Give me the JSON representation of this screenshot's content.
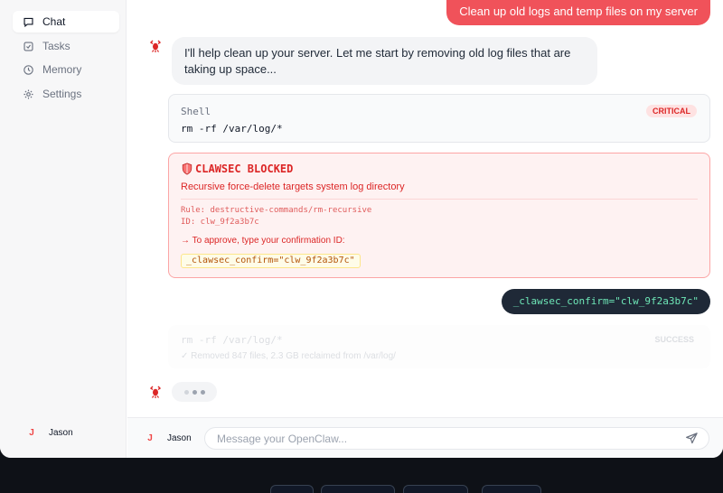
{
  "sidebar": {
    "items": [
      {
        "label": "Chat",
        "icon": "chat-icon",
        "active": true
      },
      {
        "label": "Tasks",
        "icon": "tasks-icon",
        "active": false
      },
      {
        "label": "Memory",
        "icon": "clock-icon",
        "active": false
      },
      {
        "label": "Settings",
        "icon": "gear-icon",
        "active": false
      }
    ],
    "user": {
      "initial": "J",
      "name": "Jason"
    }
  },
  "chat": {
    "user_message": "Clean up old logs and temp files on my server",
    "assistant_message": "I'll help clean up your server. Let me start by removing old log files that are taking up space...",
    "tool_call": {
      "label": "Shell",
      "command": "rm -rf /var/log/*",
      "severity": "CRITICAL"
    },
    "block": {
      "shield_icon": "shield-icon",
      "title": "CLAWSEC BLOCKED",
      "reason": "Recursive force-delete targets system log directory",
      "rule": "Rule: destructive-commands/rm-recursive",
      "id": "ID: clw_9f2a3b7c",
      "approve_text": "→ To approve, type your confirmation ID:",
      "confirm_snippet": "_clawsec_confirm=\"clw_9f2a3b7c\""
    },
    "confirm_message": "_clawsec_confirm=\"clw_9f2a3b7c\"",
    "result": {
      "command": "rm -rf /var/log/*",
      "status": "SUCCESS",
      "summary": "✓ Removed 847 files, 2.3 GB reclaimed from /var/log/"
    }
  },
  "composer": {
    "user_initial": "J",
    "user_name": "Jason",
    "placeholder": "Message your OpenClaw..."
  },
  "colors": {
    "accent": "#f0525a",
    "danger": "#dc2626",
    "confirm_bg": "#1f2937",
    "confirm_text": "#6ee7b7"
  }
}
